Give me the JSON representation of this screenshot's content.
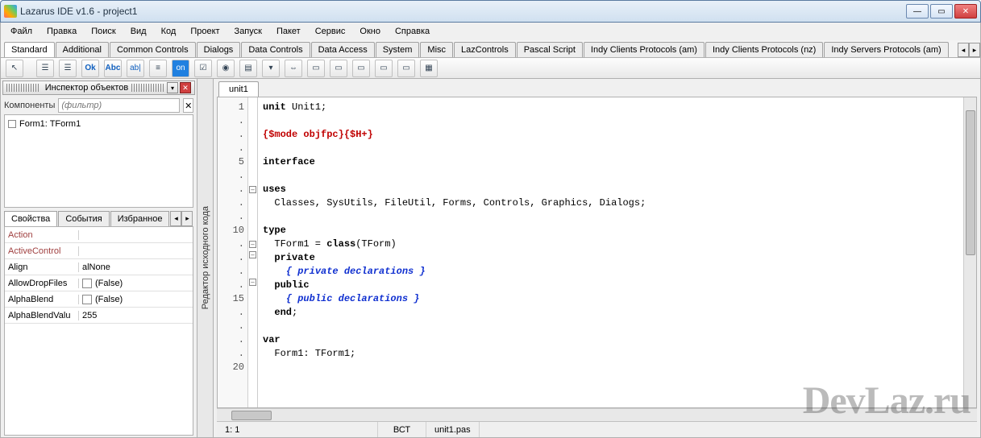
{
  "window": {
    "title": "Lazarus IDE v1.6 - project1"
  },
  "menubar": [
    "Файл",
    "Правка",
    "Поиск",
    "Вид",
    "Код",
    "Проект",
    "Запуск",
    "Пакет",
    "Сервис",
    "Окно",
    "Справка"
  ],
  "palette_tabs": [
    "Standard",
    "Additional",
    "Common Controls",
    "Dialogs",
    "Data Controls",
    "Data Access",
    "System",
    "Misc",
    "LazControls",
    "Pascal Script",
    "Indy Clients Protocols (am)",
    "Indy Clients Protocols (nz)",
    "Indy Servers Protocols (am)"
  ],
  "palette_active": 0,
  "inspector": {
    "title": "Инспектор объектов",
    "components_label": "Компоненты",
    "filter_placeholder": "(фильтр)",
    "tree": [
      "Form1: TForm1"
    ],
    "tabs": [
      "Свойства",
      "События",
      "Избранное"
    ],
    "active_tab": 0,
    "props": [
      {
        "name": "Action",
        "value": "",
        "linked": true
      },
      {
        "name": "ActiveControl",
        "value": "",
        "linked": true
      },
      {
        "name": "Align",
        "value": "alNone"
      },
      {
        "name": "AllowDropFiles",
        "value": "(False)",
        "check": true
      },
      {
        "name": "AlphaBlend",
        "value": "(False)",
        "check": true
      },
      {
        "name": "AlphaBlendValu",
        "value": "255"
      }
    ]
  },
  "side_label": "Редактор исходного кода",
  "editor": {
    "tab": "unit1",
    "gutter": [
      "1",
      ".",
      ".",
      ".",
      "5",
      ".",
      ".",
      ".",
      ".",
      "10",
      ".",
      ".",
      ".",
      ".",
      "15",
      ".",
      ".",
      ".",
      ".",
      "20"
    ],
    "code_html": "<span class='kw'>unit</span> Unit1;\n\n<span class='dir'>{$mode objfpc}{$H+}</span>\n\n<span class='kw'>interface</span>\n\n<span class='kw'>uses</span>\n  Classes, SysUtils, FileUtil, Forms, Controls, Graphics, Dialogs;\n\n<span class='kw'>type</span>\n  TForm1 = <span class='kw'>class</span>(TForm)\n  <span class='kw'>private</span>\n    <span class='cm'>{ private declarations }</span>\n  <span class='kw'>public</span>\n    <span class='cm'>{ public declarations }</span>\n  <span class='kw'>end</span>;\n\n<span class='kw'>var</span>\n  Form1: TForm1;"
  },
  "status": {
    "pos": "1: 1",
    "mode": "ВСТ",
    "file": "unit1.pas"
  },
  "watermark": "DevLaz.ru"
}
